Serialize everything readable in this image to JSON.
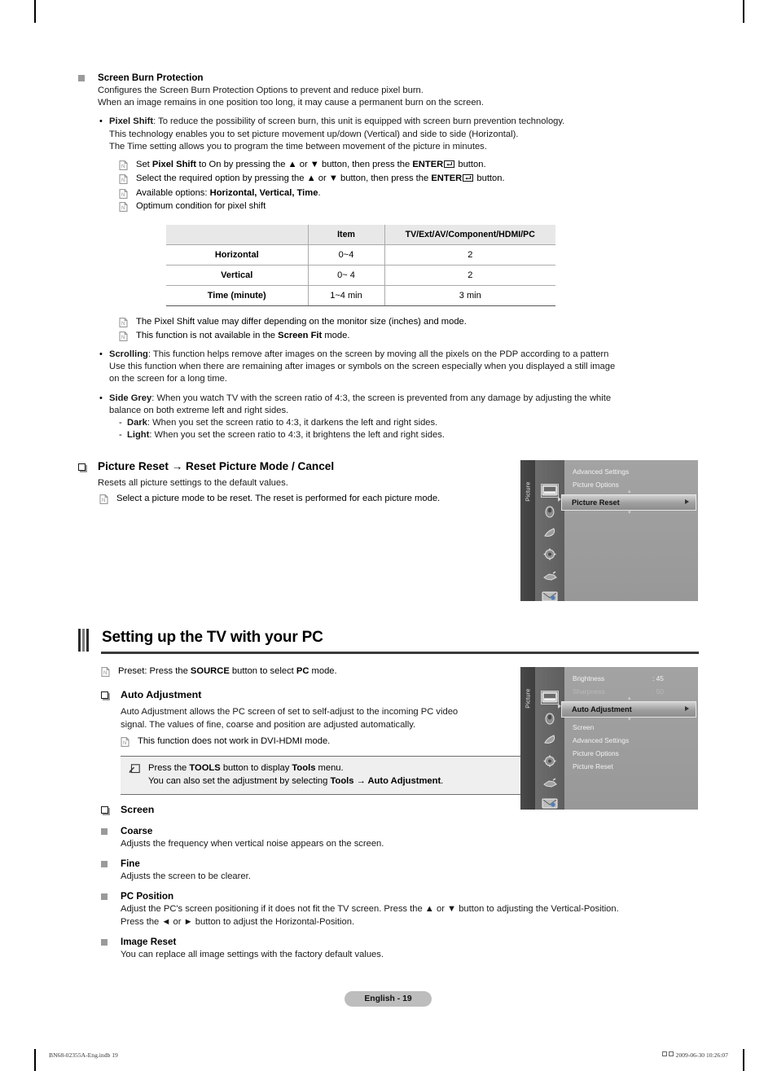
{
  "document": {
    "page_label": "English - 19",
    "print_footer_left": "BN68-02355A-Eng.indb   19",
    "print_footer_right": "2009-06-30     10:26:07"
  },
  "screen_burn": {
    "heading": "Screen Burn Protection",
    "intro_line1": "Configures the Screen Burn Protection Options to prevent and reduce pixel burn.",
    "intro_line2": "When an image remains in one position too long, it may cause a permanent burn on the screen.",
    "pixel_shift": {
      "term": "Pixel Shift",
      "line1_rest": ": To reduce the possibility of screen burn, this unit is equipped with screen burn prevention technology.",
      "line2": "This technology enables you to set picture movement up/down (Vertical) and side to side (Horizontal).",
      "line3": "The Time setting allows you to program the time between movement of the picture in minutes.",
      "notes": [
        {
          "pre": "Set ",
          "bold1": "Pixel Shift",
          "mid": " to On by pressing the ▲ or ▼ button, then press the ",
          "bold2": "ENTER",
          "post": " button."
        },
        {
          "pre": "Select the required option by pressing the ▲ or ▼ button, then press the ",
          "bold1": "",
          "mid": "",
          "bold2": "ENTER",
          "post": " button."
        },
        {
          "pre": "Available options: ",
          "bold1": "Horizontal, Vertical, Time",
          "mid": "",
          "bold2": "",
          "post": "."
        },
        {
          "pre": "Optimum condition for pixel shift",
          "bold1": "",
          "mid": "",
          "bold2": "",
          "post": ""
        }
      ]
    },
    "table": {
      "headers": [
        "",
        "Item",
        "TV/Ext/AV/Component/HDMI/PC"
      ],
      "rows": [
        [
          "Horizontal",
          "0~4",
          "2"
        ],
        [
          "Vertical",
          "0~ 4",
          "2"
        ],
        [
          "Time (minute)",
          "1~4 min",
          "3 min"
        ]
      ]
    },
    "after_table_notes": [
      {
        "pre": "The Pixel Shift value may differ depending on the monitor size (inches) and mode.",
        "bold": "",
        "post": ""
      },
      {
        "pre": "This function is not available in the ",
        "bold": "Screen Fit",
        "post": " mode."
      }
    ],
    "scrolling": {
      "term": "Scrolling",
      "line1_rest": ": This function helps remove after images on the screen by moving all the pixels on the PDP according to a pattern",
      "line2": "Use this function when there are remaining after images or symbols on the screen especially when you displayed a still image",
      "line3": "on the screen for a long time."
    },
    "side_grey": {
      "term": "Side Grey",
      "line1_rest": ": When you watch TV with the screen ratio of 4:3, the screen is prevented from any damage by adjusting the white",
      "line2": "balance on both extreme left and right sides.",
      "sub": [
        {
          "term": "Dark",
          "rest": ": When you set the screen ratio to 4:3, it darkens the left and right sides."
        },
        {
          "term": "Light",
          "rest": ": When you set the screen ratio to 4:3, it brightens the left and right sides."
        }
      ]
    }
  },
  "picture_reset": {
    "heading": "Picture Reset → Reset Picture Mode / Cancel",
    "body": "Resets all picture settings to the default values.",
    "note": "Select a picture mode to be reset. The reset is performed for each picture mode."
  },
  "osd_picture_reset": {
    "tab_label": "Picture",
    "items": [
      {
        "label": "Advanced Settings",
        "value": "",
        "state": "normal"
      },
      {
        "label": "Picture Options",
        "value": "",
        "state": "normal"
      }
    ],
    "selected": "Picture Reset",
    "icons": [
      "picture-icon",
      "sound-icon",
      "channel-icon",
      "setup-icon",
      "input-icon",
      "support-icon"
    ]
  },
  "pc_section": {
    "title": "Setting up the TV with your PC",
    "preset_note": {
      "pre": "Preset: Press the ",
      "bold1": "SOURCE",
      "mid": " button to select ",
      "bold2": "PC",
      "post": " mode."
    },
    "auto_adjustment": {
      "heading": "Auto Adjustment",
      "line1": "Auto Adjustment allows the PC screen of set to self-adjust to the incoming PC video",
      "line2": "signal. The values of fine, coarse and position are adjusted automatically.",
      "note": "This function does not work in DVI-HDMI mode.",
      "tools_line1_pre": "Press the ",
      "tools_line1_bold1": "TOOLS",
      "tools_line1_mid": " button to display ",
      "tools_line1_bold2": "Tools",
      "tools_line1_post": " menu.",
      "tools_line2_pre": "You can also set the adjustment by selecting ",
      "tools_line2_bold": "Tools → Auto Adjustment",
      "tools_line2_post": "."
    },
    "screen": {
      "heading": "Screen",
      "entries": [
        {
          "title": "Coarse",
          "desc_lines": [
            "Adjusts the frequency when vertical noise appears on the screen."
          ]
        },
        {
          "title": "Fine",
          "desc_lines": [
            "Adjusts the screen to be clearer."
          ]
        },
        {
          "title": "PC Position",
          "desc_lines": [
            "Adjust the PC's screen positioning if it does not fit the TV screen. Press the ▲ or ▼ button to adjusting the Vertical-Position.",
            "Press the ◄ or ► button to adjust the Horizontal-Position."
          ]
        },
        {
          "title": "Image Reset",
          "desc_lines": [
            "You can replace all image settings with the factory default values."
          ]
        }
      ]
    }
  },
  "osd_auto_adjustment": {
    "tab_label": "Picture",
    "top_items": [
      {
        "label": "Brightness",
        "value": ": 45",
        "state": "normal"
      },
      {
        "label": "Sharpness",
        "value": ": 50",
        "state": "dim"
      }
    ],
    "selected": "Auto Adjustment",
    "below_items": [
      {
        "label": "Screen",
        "value": "",
        "state": "normal"
      },
      {
        "label": "Advanced Settings",
        "value": "",
        "state": "normal"
      },
      {
        "label": "Picture Options",
        "value": "",
        "state": "normal"
      },
      {
        "label": "Picture Reset",
        "value": "",
        "state": "normal"
      }
    ],
    "icons": [
      "picture-icon",
      "sound-icon",
      "channel-icon",
      "setup-icon",
      "input-icon",
      "support-icon"
    ]
  }
}
